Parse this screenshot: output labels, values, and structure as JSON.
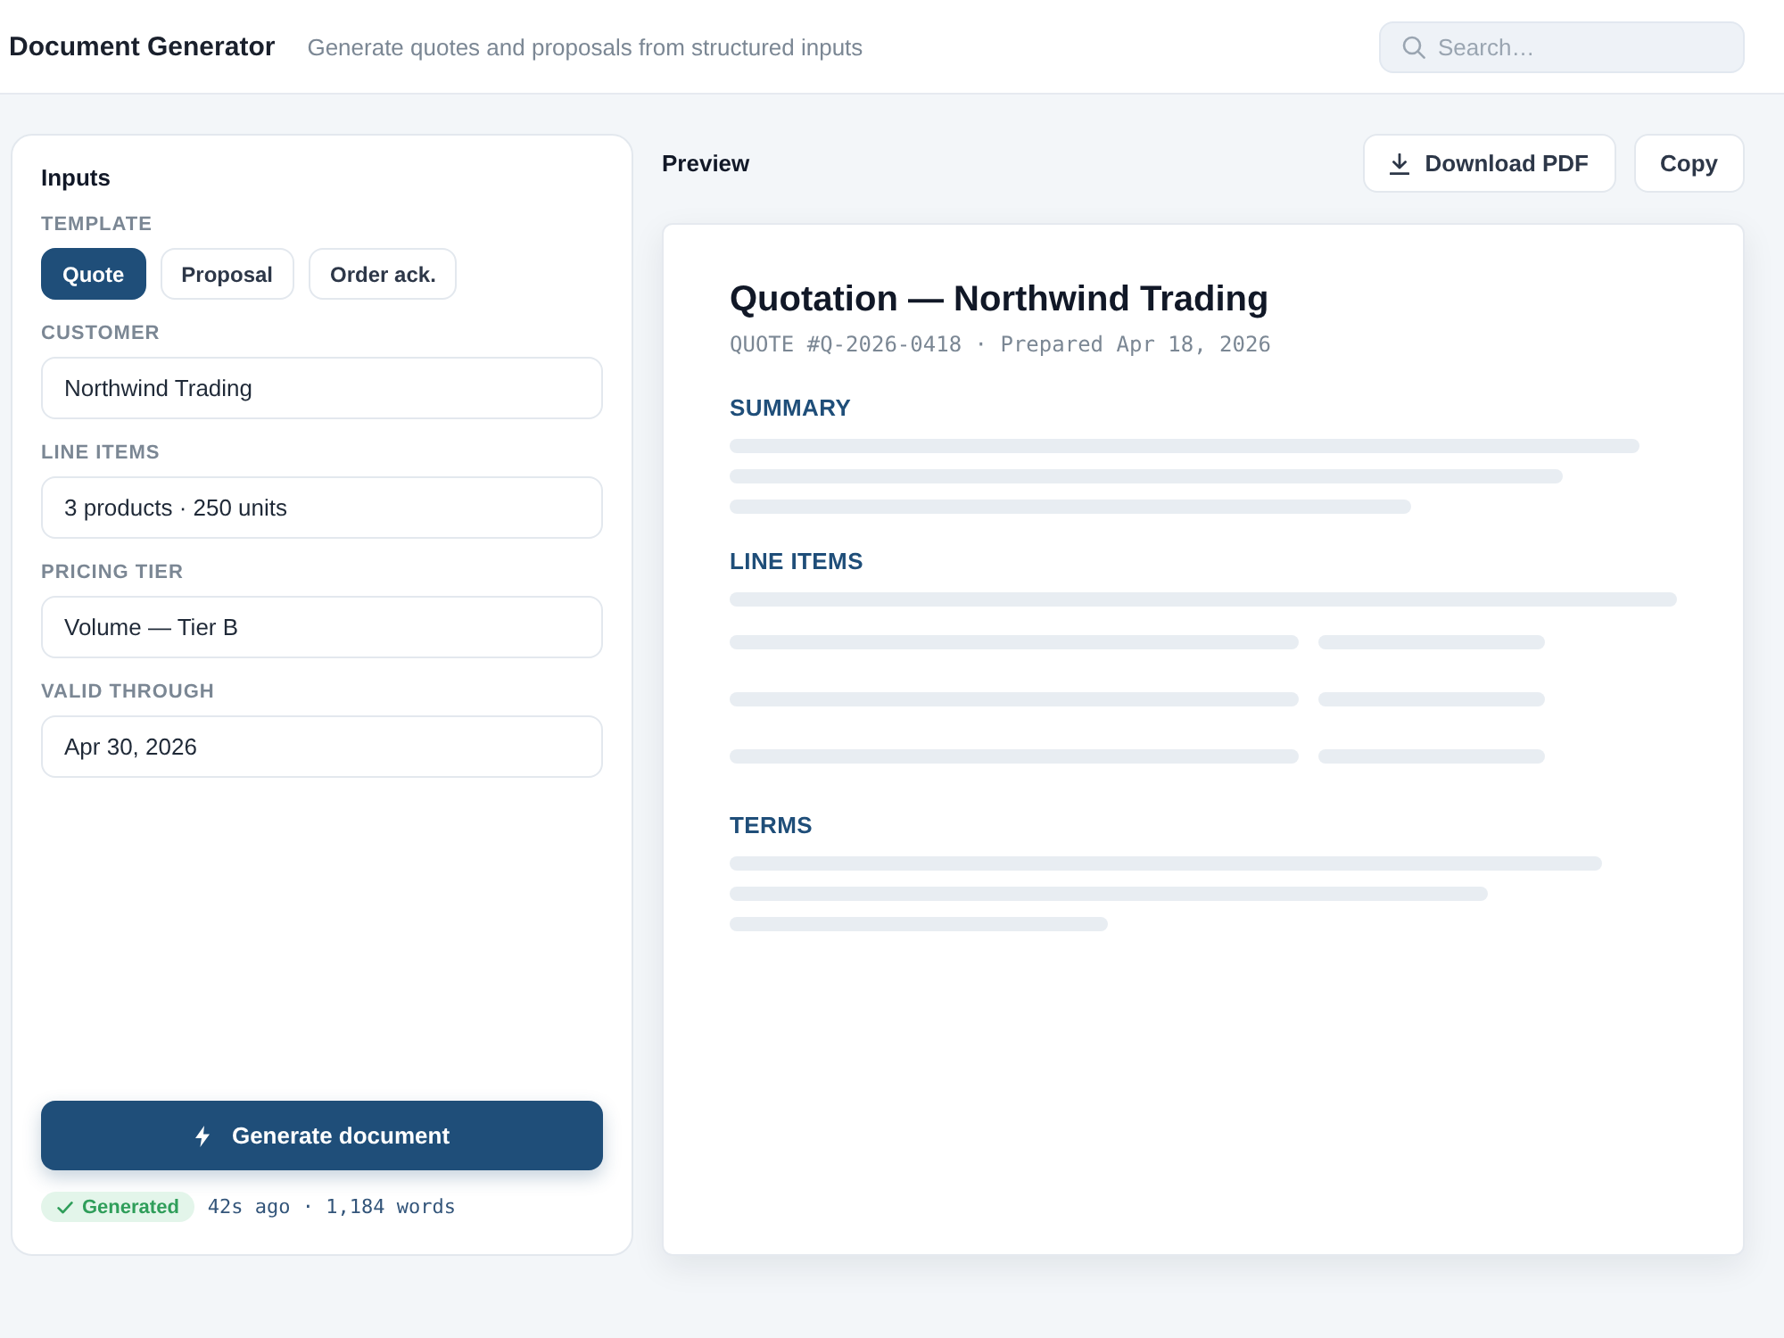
{
  "header": {
    "title": "Document Generator",
    "subtitle": "Generate quotes and proposals from structured inputs",
    "search": {
      "placeholder": "Search…"
    }
  },
  "inputs": {
    "title": "Inputs",
    "template": {
      "label": "TEMPLATE",
      "options": [
        {
          "label": "Quote",
          "selected": true
        },
        {
          "label": "Proposal",
          "selected": false
        },
        {
          "label": "Order ack.",
          "selected": false
        }
      ]
    },
    "fields": [
      {
        "label": "CUSTOMER",
        "value": "Northwind Trading"
      },
      {
        "label": "LINE ITEMS",
        "value": "3 products · 250 units"
      },
      {
        "label": "PRICING TIER",
        "value": "Volume — Tier B"
      },
      {
        "label": "VALID THROUGH",
        "value": "Apr 30, 2026"
      }
    ],
    "generate_button": "Generate document",
    "status": {
      "badge": "Generated",
      "detail": "42s ago · 1,184 words"
    }
  },
  "preview": {
    "title": "Preview",
    "actions": [
      {
        "label": "Download PDF",
        "kind": "download"
      },
      {
        "label": "Copy",
        "kind": "plain"
      }
    ],
    "document": {
      "title": "Quotation — Northwind Trading",
      "meta": "QUOTE #Q-2026-0418 · Prepared Apr 18, 2026",
      "sections": [
        {
          "heading": "SUMMARY",
          "kind": "paragraph"
        },
        {
          "heading": "LINE ITEMS",
          "kind": "table"
        },
        {
          "heading": "TERMS",
          "kind": "paragraph"
        }
      ]
    }
  }
}
